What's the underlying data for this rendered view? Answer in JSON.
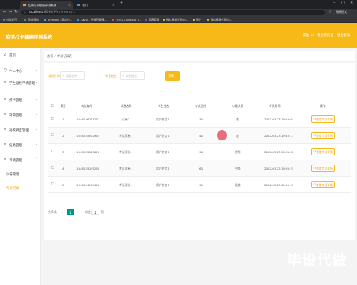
{
  "browser": {
    "tabs": [
      {
        "label": "疫情打卡健康评测系统",
        "active": true
      },
      {
        "label": "我们",
        "active": false
      }
    ],
    "url_host": "localhost",
    "url_path": ":8080/#/mymenu/...",
    "bookmarks": [
      {
        "label": "应用程序",
        "color": "#4285f4"
      },
      {
        "label": "图标网站",
        "color": "#34a853"
      },
      {
        "label": "Element - 网站快...",
        "color": "#409eff"
      },
      {
        "label": "Layui - 经典开源模...",
        "color": "#1e9fff"
      },
      {
        "label": "HTML5 Website T...",
        "color": "#e44d26"
      },
      {
        "label": "面客管理",
        "color": "#7c4dff"
      },
      {
        "label": "微信模板代码加...",
        "color": "#f2b705"
      },
      {
        "label": "图片",
        "color": "#f2b705"
      },
      {
        "label": "微信模板代码加...",
        "color": "#f2b705"
      }
    ],
    "profile_label": "无痕模式"
  },
  "header": {
    "title": "疫情打卡健康评测系统",
    "user_label": "学生 all",
    "front_link": "退出到前台",
    "logout_link": "退出登录"
  },
  "sidebar": {
    "items": [
      {
        "label": "首页",
        "icon": "home-icon",
        "glyph": "⌂"
      },
      {
        "label": "个人中心",
        "icon": "user-icon",
        "glyph": "☺"
      },
      {
        "label": "学生返校申请管理",
        "icon": "list-icon",
        "glyph": "≡"
      },
      {
        "label": "打卡管理",
        "icon": "list-icon",
        "glyph": "≡"
      },
      {
        "label": "日常管理",
        "icon": "list-icon",
        "glyph": "≡"
      },
      {
        "label": "返校调查管理",
        "icon": "list-icon",
        "glyph": "≡"
      },
      {
        "label": "信息管理",
        "icon": "list-icon",
        "glyph": "≡"
      },
      {
        "label": "考试管理",
        "icon": "list-icon",
        "glyph": "≡"
      }
    ],
    "subitems": [
      {
        "label": "试卷管理",
        "active": false
      },
      {
        "label": "考试记录",
        "active": true
      }
    ]
  },
  "breadcrumb": {
    "home": "首页",
    "separator": "/",
    "current": "考试记录表"
  },
  "search": {
    "field1_label": "试卷名称",
    "field1_placeholder": "试卷名称",
    "field2_label": "学生姓名",
    "field2_placeholder": "学生姓名",
    "button_label": "查询"
  },
  "table": {
    "columns": [
      "索引",
      "考试编号",
      "试卷名称",
      "学生姓名",
      "考试总分",
      "心理状况",
      "考试时间",
      "操作"
    ],
    "rows": [
      {
        "index": "1",
        "exam_no": "1648036083232",
        "paper": "试卷2",
        "student": "用户姓名1",
        "score": "30",
        "mental": "差",
        "time": "2022-03-23 19:53:03"
      },
      {
        "index": "2",
        "exam_no": "1648035912965",
        "paper": "考试试卷1",
        "student": "用户姓名1",
        "score": "40",
        "mental": "差",
        "time": "2022-03-23 19:45:13"
      },
      {
        "index": "3",
        "exam_no": "1648035049628",
        "paper": "考试试卷1",
        "student": "用户姓名1",
        "score": "96",
        "mental": "优秀",
        "time": "2022-03-23 19:30:58"
      },
      {
        "index": "4",
        "exam_no": "1648035025280",
        "paper": "考试试卷1",
        "student": "用户姓名1",
        "score": "60",
        "mental": "中等",
        "time": "2022-03-23 19:30:25"
      },
      {
        "index": "5",
        "exam_no": "1648034989446",
        "paper": "考试试卷1",
        "student": "用户姓名1",
        "score": "15",
        "mental": "极差",
        "time": "2022-03-23 19:29:55"
      }
    ],
    "action_label": "查看考试详情"
  },
  "pagination": {
    "total_text": "共 5 条",
    "prev": "‹",
    "current_page": "1",
    "next": "›",
    "goto_prefix": "前往",
    "goto_value": "1",
    "goto_suffix": "页"
  },
  "watermark": "毕设代做"
}
